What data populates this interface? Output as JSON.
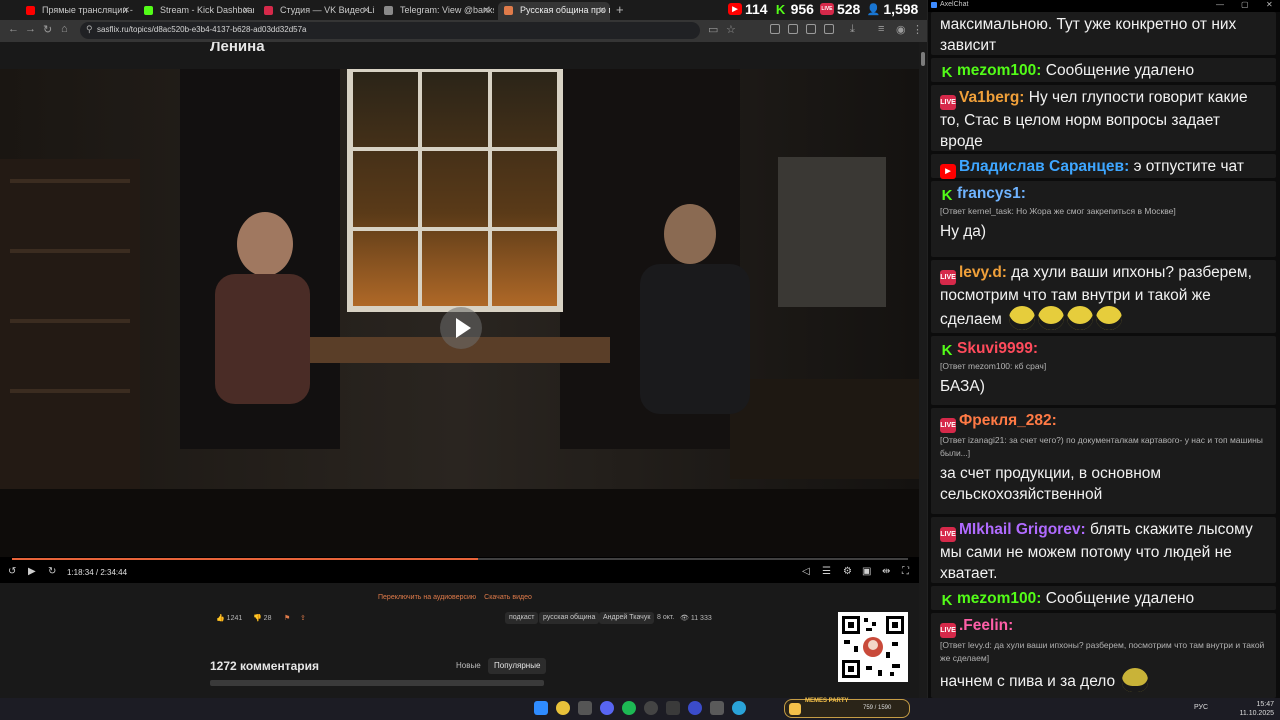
{
  "tabs": [
    {
      "title": "Прямые трансляции - YouTube",
      "color": "#ff0000",
      "active": false
    },
    {
      "title": "Stream - Kick Dashboard",
      "color": "#53fc18",
      "active": false
    },
    {
      "title": "Студия — VK Видео Live",
      "color": "#d6294a",
      "active": false
    },
    {
      "title": "Telegram: View @banksta",
      "color": "#8a8a8a",
      "active": false
    },
    {
      "title": "Русская община про мигрант",
      "color": "#e07b4a",
      "active": true
    }
  ],
  "counters": [
    {
      "platform": "youtube",
      "value": "114",
      "color": "#ff0000",
      "icon_text": "▶"
    },
    {
      "platform": "kick",
      "value": "956",
      "color": "#53fc18",
      "icon_text": "K"
    },
    {
      "platform": "vk-live",
      "value": "528",
      "color": "#d6294a",
      "icon_text": "LIVE"
    },
    {
      "platform": "total",
      "value": "1,598",
      "color": "#4aa3ff",
      "icon_text": "👤"
    }
  ],
  "address": {
    "url": "sasflix.ru/topics/d8ac520b-e3b4-4137-b628-ad03dd32d57a"
  },
  "video": {
    "title": "Ленина",
    "progress": 0.52,
    "timecode": "1:18:34 / 2:34:44"
  },
  "page_actions": {
    "audio": "Переключить на аудиоверсию",
    "download": "Скачать видео"
  },
  "meta": {
    "likes": "1241",
    "dislikes": "28",
    "tags": [
      "подкаст",
      "русская община",
      "Андрей Ткачук"
    ],
    "date": "8 окт.",
    "views": "11 333"
  },
  "comments": {
    "title": "1272 комментария",
    "sort_new": "Новые",
    "sort_popular": "Популярные"
  },
  "chat": {
    "window_title": "AxelChat",
    "messages": [
      {
        "platform": "",
        "user": "",
        "user_color": "",
        "reply": "",
        "text": "максимальною. Тут уже конкретно от них зависит",
        "emotes": 0
      },
      {
        "platform": "kick",
        "user": "mezom100:",
        "user_color": "#53fc18",
        "reply": "",
        "text": "Сообщение удалено",
        "emotes": 0
      },
      {
        "platform": "vk",
        "user": "Va1berg:",
        "user_color": "#f0a03a",
        "reply": "",
        "text": "Ну чел глупости говорит какие то, Стас в целом норм вопросы задает вроде",
        "emotes": 0
      },
      {
        "platform": "youtube",
        "user": "Владислав Саранцев:",
        "user_color": "#3ea6ff",
        "reply": "",
        "text": "э отпустите чат",
        "emotes": 0
      },
      {
        "platform": "kick",
        "user": "francys1:",
        "user_color": "#6fb3ff",
        "reply": "[Ответ kernel_task: Но Жора же смог закрепиться в Москве]",
        "text": "Ну да)",
        "emotes": 0
      },
      {
        "platform": "vk",
        "user": "levy.d:",
        "user_color": "#f0a03a",
        "reply": "",
        "text": "да хули ваши ипхоны? разберем, посмотрим что там внутри и такой же сделаем",
        "emotes": 4
      },
      {
        "platform": "kick",
        "user": "Skuvi9999:",
        "user_color": "#ff4b5c",
        "reply": "[Ответ mezom100: кб срач]",
        "text": "БАЗА)",
        "emotes": 0
      },
      {
        "platform": "vk",
        "user": "Фрекля_282:",
        "user_color": "#ff7a45",
        "reply": "[Ответ izanagi21: за счет чего?) по документалкам картавого- у нас и топ машины были...]",
        "text": "за счет продукции, в основном сельскохозяйственной",
        "emotes": 0
      },
      {
        "platform": "vk",
        "user": "MIkhail Grigorev:",
        "user_color": "#b06bff",
        "reply": "",
        "text": "блять скажите лысому мы сами не можем потому что людей не хватает.",
        "emotes": 0
      },
      {
        "platform": "kick",
        "user": "mezom100:",
        "user_color": "#53fc18",
        "reply": "",
        "text": "Сообщение удалено",
        "emotes": 0
      },
      {
        "platform": "vk",
        "user": ".Feelin:",
        "user_color": "#ff5fa8",
        "reply": "[Ответ levy.d: да хули ваши ипхоны? разберем, посмотрим что там внутри и такой же сделаем]",
        "text": "начнем с пива и за дело",
        "emotes": 1
      }
    ]
  },
  "taskbar": {
    "widget_label": "MEMES PARTY",
    "widget_count": "759 / 1590",
    "lang": "РУС",
    "time": "15:47",
    "date": "11.10.2025"
  }
}
